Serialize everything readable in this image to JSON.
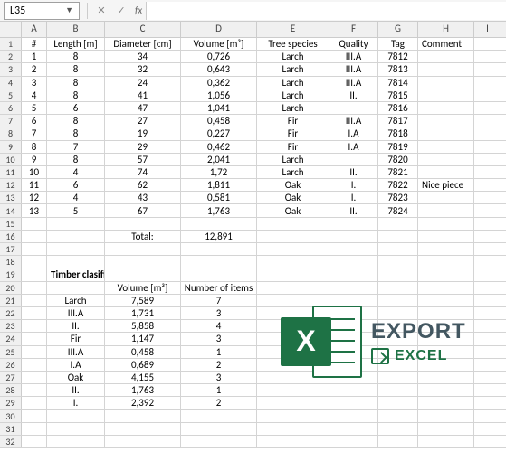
{
  "formula_bar": {
    "cell_ref": "L35",
    "fx": "fx",
    "formula": ""
  },
  "columns": [
    "A",
    "B",
    "C",
    "D",
    "E",
    "F",
    "G",
    "H",
    "I"
  ],
  "headers": {
    "num": "#",
    "length": "Length [m]",
    "diameter": "Diameter [cm]",
    "volume": "Volume [m³]",
    "species": "Tree species",
    "quality": "Quality",
    "tag": "Tag",
    "comment": "Comment"
  },
  "rows": [
    {
      "n": "1",
      "len": "8",
      "dia": "34",
      "vol": "0,726",
      "sp": "Larch",
      "q": "III.A",
      "tag": "7812",
      "c": ""
    },
    {
      "n": "2",
      "len": "8",
      "dia": "32",
      "vol": "0,643",
      "sp": "Larch",
      "q": "III.A",
      "tag": "7813",
      "c": ""
    },
    {
      "n": "3",
      "len": "8",
      "dia": "24",
      "vol": "0,362",
      "sp": "Larch",
      "q": "III.A",
      "tag": "7814",
      "c": ""
    },
    {
      "n": "4",
      "len": "8",
      "dia": "41",
      "vol": "1,056",
      "sp": "Larch",
      "q": "II.",
      "tag": "7815",
      "c": ""
    },
    {
      "n": "5",
      "len": "6",
      "dia": "47",
      "vol": "1,041",
      "sp": "Larch",
      "q": "",
      "tag": "7816",
      "c": ""
    },
    {
      "n": "6",
      "len": "8",
      "dia": "27",
      "vol": "0,458",
      "sp": "Fir",
      "q": "III.A",
      "tag": "7817",
      "c": ""
    },
    {
      "n": "7",
      "len": "8",
      "dia": "19",
      "vol": "0,227",
      "sp": "Fir",
      "q": "I.A",
      "tag": "7818",
      "c": ""
    },
    {
      "n": "8",
      "len": "7",
      "dia": "29",
      "vol": "0,462",
      "sp": "Fir",
      "q": "I.A",
      "tag": "7819",
      "c": ""
    },
    {
      "n": "9",
      "len": "8",
      "dia": "57",
      "vol": "2,041",
      "sp": "Larch",
      "q": "",
      "tag": "7820",
      "c": ""
    },
    {
      "n": "10",
      "len": "4",
      "dia": "74",
      "vol": "1,72",
      "sp": "Larch",
      "q": "II.",
      "tag": "7821",
      "c": ""
    },
    {
      "n": "11",
      "len": "6",
      "dia": "62",
      "vol": "1,811",
      "sp": "Oak",
      "q": "I.",
      "tag": "7822",
      "c": "Nice piece"
    },
    {
      "n": "12",
      "len": "4",
      "dia": "43",
      "vol": "0,581",
      "sp": "Oak",
      "q": "I.",
      "tag": "7823",
      "c": ""
    },
    {
      "n": "13",
      "len": "5",
      "dia": "67",
      "vol": "1,763",
      "sp": "Oak",
      "q": "II.",
      "tag": "7824",
      "c": ""
    }
  ],
  "total": {
    "label": "Total:",
    "value": "12,891"
  },
  "classification": {
    "title": "Timber clasification",
    "vol_h": "Volume [m³]",
    "num_h": "Number of items",
    "rows": [
      {
        "name": "Larch",
        "vol": "7,589",
        "n": "7"
      },
      {
        "name": "III.A",
        "vol": "1,731",
        "n": "3"
      },
      {
        "name": "II.",
        "vol": "5,858",
        "n": "4"
      },
      {
        "name": "Fir",
        "vol": "1,147",
        "n": "3"
      },
      {
        "name": "III.A",
        "vol": "0,458",
        "n": "1"
      },
      {
        "name": "I.A",
        "vol": "0,689",
        "n": "2"
      },
      {
        "name": "Oak",
        "vol": "4,155",
        "n": "3"
      },
      {
        "name": "II.",
        "vol": "1,763",
        "n": "1"
      },
      {
        "name": "I.",
        "vol": "2,392",
        "n": "2"
      }
    ]
  },
  "logo": {
    "export": "EXPORT",
    "excel": "EXCEL",
    "x": "X"
  }
}
